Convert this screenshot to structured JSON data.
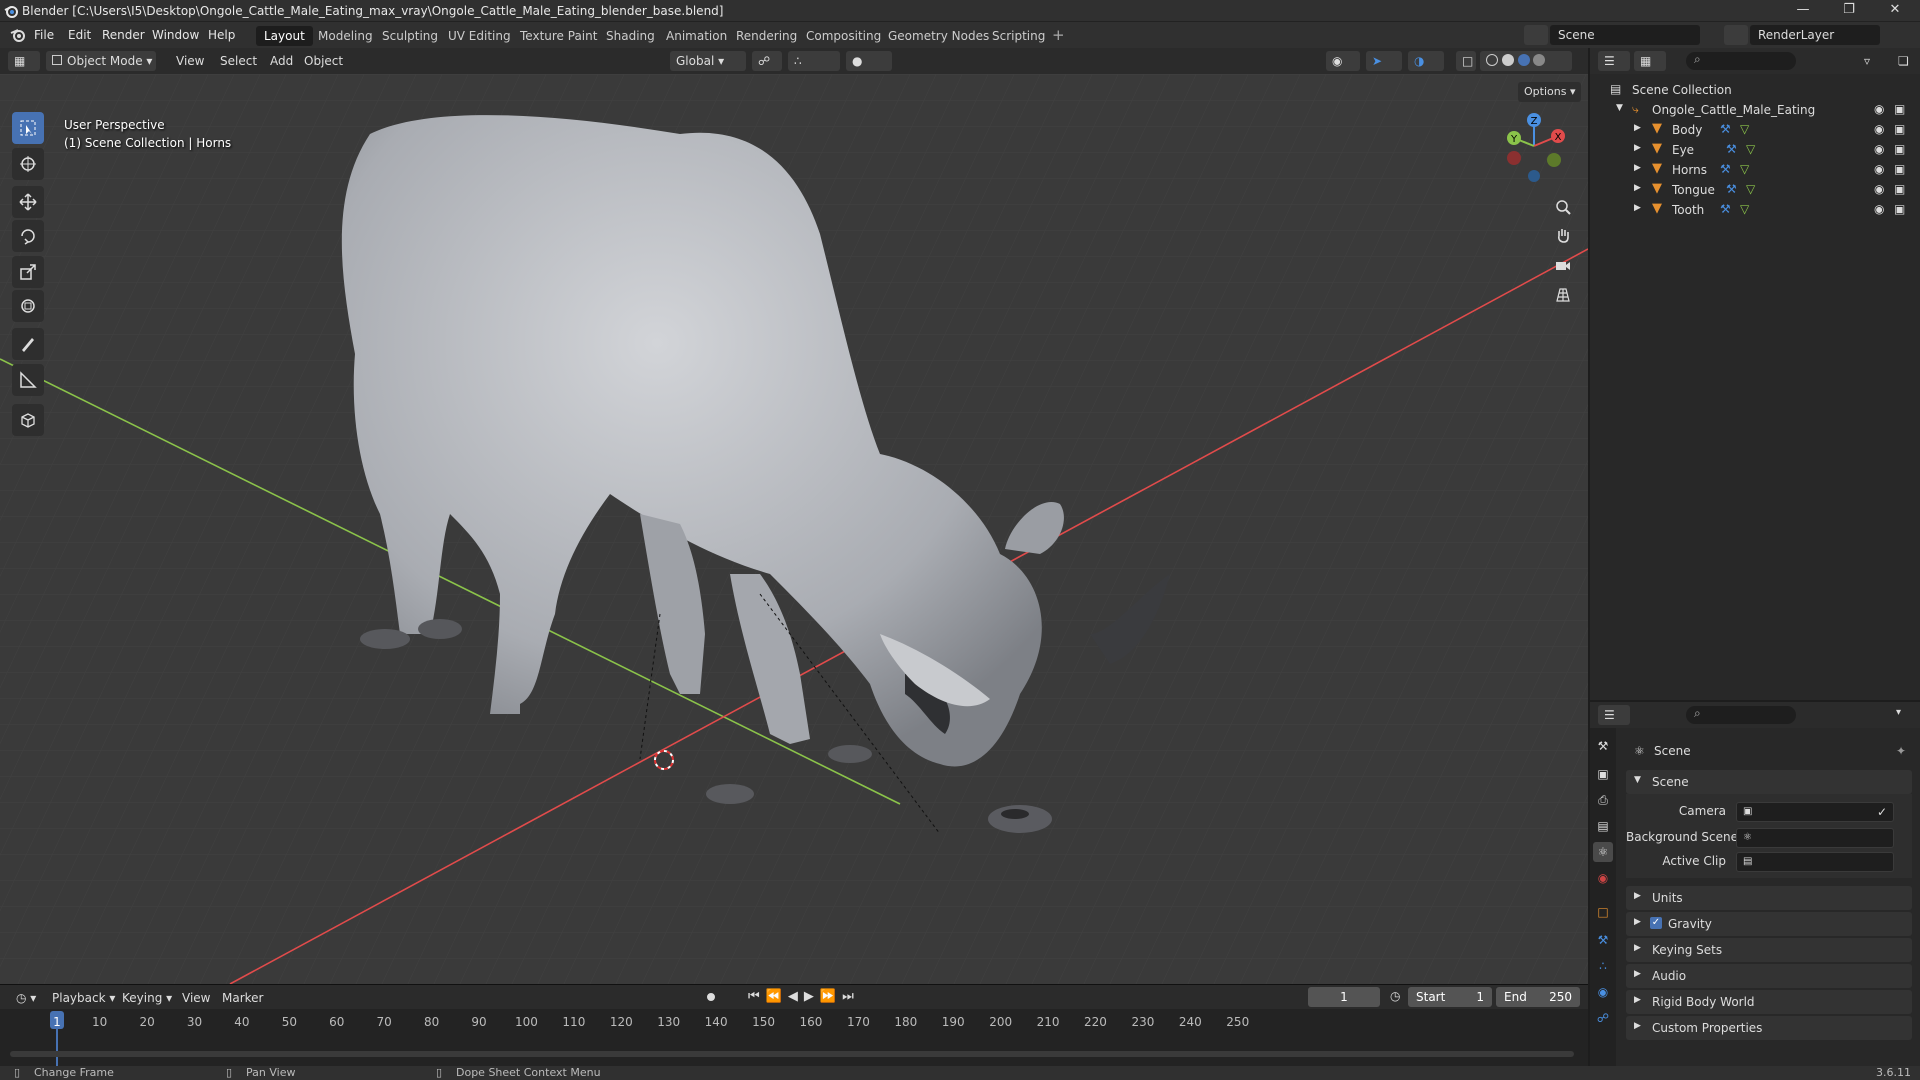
{
  "titlebar": {
    "title": "Blender [C:\\Users\\I5\\Desktop\\Ongole_Cattle_Male_Eating_max_vray\\Ongole_Cattle_Male_Eating_blender_base.blend]"
  },
  "menu": {
    "file": "File",
    "edit": "Edit",
    "render": "Render",
    "window": "Window",
    "help": "Help"
  },
  "workspaces": [
    "Layout",
    "Modeling",
    "Sculpting",
    "UV Editing",
    "Texture Paint",
    "Shading",
    "Animation",
    "Rendering",
    "Compositing",
    "Geometry Nodes",
    "Scripting"
  ],
  "topright": {
    "scene": "Scene",
    "renderlayer": "RenderLayer"
  },
  "viewport_header": {
    "mode": "Object Mode",
    "view": "View",
    "select": "Select",
    "add": "Add",
    "object": "Object",
    "transform": "Global",
    "options": "Options"
  },
  "viewport": {
    "perspective": "User Perspective",
    "collection": "(1) Scene Collection | Horns"
  },
  "gizmo": {
    "z": "Z",
    "y": "Y",
    "x": "X"
  },
  "outliner": {
    "root": "Scene Collection",
    "collection": "Ongole_Cattle_Male_Eating",
    "items": [
      "Body",
      "Eye",
      "Horns",
      "Tongue",
      "Tooth"
    ]
  },
  "properties": {
    "header": "Scene",
    "section": "Scene",
    "camera_label": "Camera",
    "bgscene_label": "Background Scene",
    "clip_label": "Active Clip",
    "sections": [
      "Units",
      "Gravity",
      "Keying Sets",
      "Audio",
      "Rigid Body World",
      "Custom Properties"
    ],
    "gravity_checked": true
  },
  "timeline": {
    "playback": "Playback",
    "keying": "Keying",
    "view": "View",
    "marker": "Marker",
    "current_frame": "1",
    "start_label": "Start",
    "start": "1",
    "end_label": "End",
    "end": "250",
    "ticks": [
      "1",
      "10",
      "20",
      "30",
      "40",
      "50",
      "60",
      "70",
      "80",
      "90",
      "100",
      "110",
      "120",
      "130",
      "140",
      "150",
      "160",
      "170",
      "180",
      "190",
      "200",
      "210",
      "220",
      "230",
      "240",
      "250"
    ]
  },
  "statusbar": {
    "change_frame": "Change Frame",
    "pan_view": "Pan View",
    "context_menu": "Dope Sheet Context Menu",
    "version": "3.6.11"
  },
  "colors": {
    "accent": "#4772b3",
    "axis_x": "#e14b4b",
    "axis_y": "#8bc34a",
    "axis_z": "#4a90e2",
    "object_orange": "#e6902f"
  }
}
